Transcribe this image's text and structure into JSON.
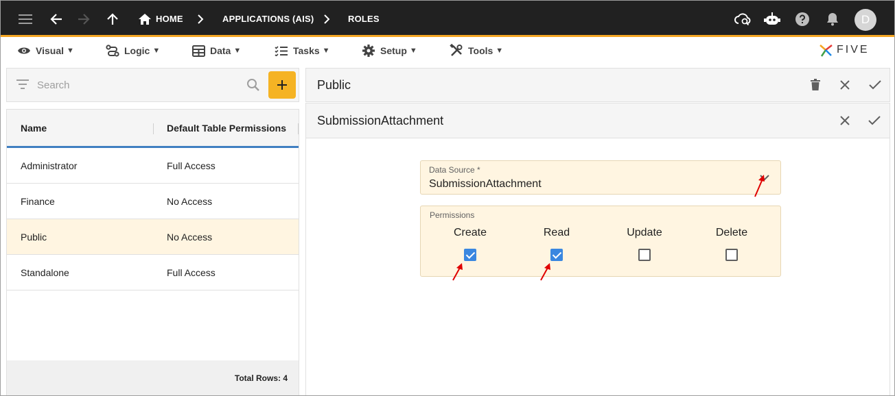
{
  "appbar": {
    "breadcrumbs": [
      {
        "label": "HOME"
      },
      {
        "label": "APPLICATIONS (AIS)"
      },
      {
        "label": "ROLES"
      }
    ],
    "avatar_initial": "D"
  },
  "menu": [
    {
      "label": "Visual",
      "icon": "eye-icon"
    },
    {
      "label": "Logic",
      "icon": "logic-icon"
    },
    {
      "label": "Data",
      "icon": "table-icon"
    },
    {
      "label": "Tasks",
      "icon": "tasks-icon"
    },
    {
      "label": "Setup",
      "icon": "gear-icon"
    },
    {
      "label": "Tools",
      "icon": "tools-icon"
    }
  ],
  "menu_caret": "▼",
  "logo": {
    "text": "FIVE"
  },
  "search": {
    "placeholder": "Search"
  },
  "grid": {
    "columns": [
      "Name",
      "Default Table Permissions"
    ],
    "rows": [
      {
        "name": "Administrator",
        "permission": "Full Access"
      },
      {
        "name": "Finance",
        "permission": "No Access"
      },
      {
        "name": "Public",
        "permission": "No Access"
      },
      {
        "name": "Standalone",
        "permission": "Full Access"
      }
    ],
    "selected_row": "Public",
    "total_rows": "Total Rows: 4"
  },
  "detail": {
    "title": "Public",
    "subtitle": "SubmissionAttachment",
    "data_source_label": "Data Source *",
    "data_source_value": "SubmissionAttachment",
    "permissions_label": "Permissions",
    "permissions": [
      {
        "label": "Create",
        "checked": true
      },
      {
        "label": "Read",
        "checked": true
      },
      {
        "label": "Update",
        "checked": false
      },
      {
        "label": "Delete",
        "checked": false
      }
    ]
  },
  "colors": {
    "appbar_bg": "#212121",
    "accent": "#f5a623",
    "add_button": "#f5b324",
    "selection": "#fff5e1",
    "checkbox_checked": "#3a87e0",
    "annotation_arrow": "#e00000"
  }
}
